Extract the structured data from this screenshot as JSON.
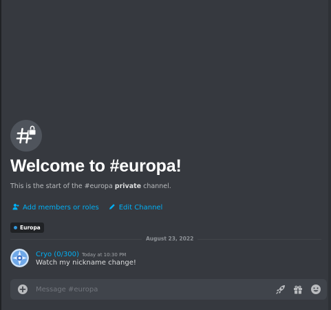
{
  "channel": {
    "welcome_title": "Welcome to #europa!",
    "intro_prefix": "This is the start of the #europa ",
    "intro_emphasis": "private",
    "intro_suffix": " channel."
  },
  "actions": {
    "add_members_label": "Add members or roles",
    "edit_channel_label": "Edit Channel"
  },
  "tag": {
    "label": "Europa",
    "color": "#3498db"
  },
  "divider": {
    "date": "August 23, 2022"
  },
  "message": {
    "username": "Cryo (0/300)",
    "timestamp": "Today at 10:30 PM",
    "text": "Watch my nickname change!"
  },
  "composer": {
    "placeholder": "Message #europa",
    "tools": [
      "rocket-icon",
      "gift-icon",
      "emoji-icon"
    ]
  },
  "colors": {
    "background": "#36393f",
    "accent": "#00aff4",
    "composer": "#40444b"
  }
}
